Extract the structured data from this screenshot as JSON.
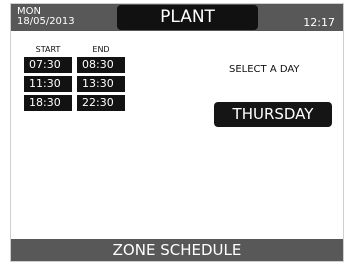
{
  "header": {
    "day": "MON",
    "date": "18/05/2013",
    "title": "PLANT",
    "time": "12:17"
  },
  "schedule": {
    "start_header": "START",
    "end_header": "END",
    "rows": [
      {
        "start": "07:30",
        "end": "08:30"
      },
      {
        "start": "11:30",
        "end": "13:30"
      },
      {
        "start": "18:30",
        "end": "22:30"
      }
    ]
  },
  "day_selector": {
    "prompt": "SELECT A DAY",
    "selected": "THURSDAY"
  },
  "footer": {
    "title": "ZONE SCHEDULE"
  }
}
